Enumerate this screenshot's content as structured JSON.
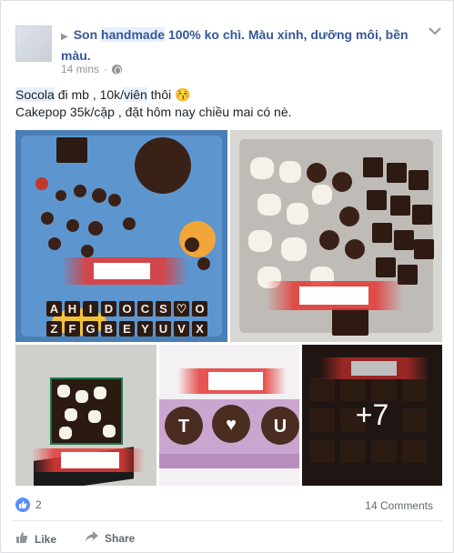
{
  "post": {
    "author_arrow": "▶",
    "title_pre": "Son ",
    "title_highlight": "handmade",
    "title_post": " 100% ko chì. Màu xinh, dưỡng môi, bền màu.",
    "time": "14 mins",
    "line1_tag": "Socola",
    "line1_mid": " đi mb , 10k/",
    "line1_tag2": "viên",
    "line1_end": " thôi 😚",
    "line2": "Cakepop 35k/cặp , đặt hôm nay chiều mai có nè."
  },
  "photos": {
    "letters_row1": [
      "A",
      "H",
      "I",
      "D",
      "O",
      "C",
      "S",
      "♡",
      "O"
    ],
    "letters_row2": [
      "Z",
      "F",
      "G",
      "B",
      "E",
      "Y",
      "U",
      "V",
      "X"
    ],
    "box_letters": [
      "T",
      "♥",
      "U"
    ],
    "more_count": "+7"
  },
  "footer": {
    "likes": "2",
    "comments": "14 Comments",
    "like_label": "Like",
    "share_label": "Share"
  },
  "colors": {
    "link": "#365899",
    "meta": "#90949c",
    "like_blue": "#5890ff"
  }
}
